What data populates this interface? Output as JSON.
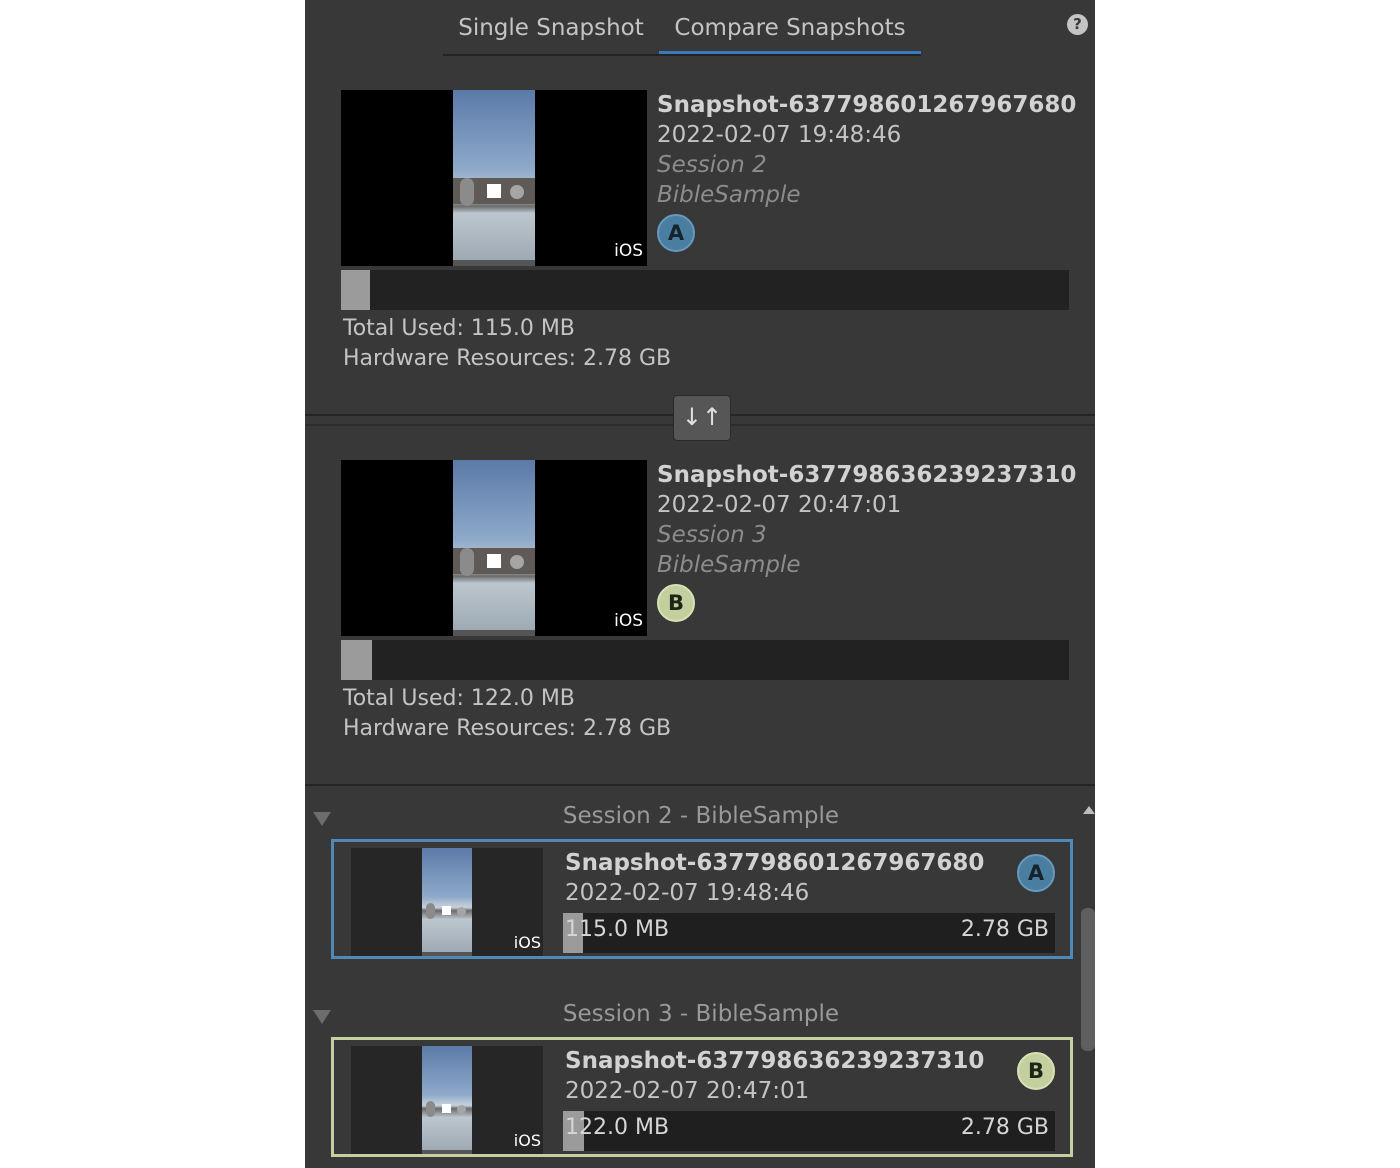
{
  "tabs": [
    {
      "label": "Single Snapshot",
      "active": false
    },
    {
      "label": "Compare Snapshots",
      "active": true
    }
  ],
  "help_icon": "question-circle-icon",
  "snapshot_a": {
    "name": "Snapshot-637798601267967680",
    "date": "2022-02-07 19:48:46",
    "session": "Session 2",
    "project": "BibleSample",
    "platform": "iOS",
    "badge": "A",
    "used_fraction": 0.04,
    "total_used": "Total Used: 115.0 MB",
    "hardware": "Hardware Resources: 2.78 GB"
  },
  "swap_icon": "swap-vertical-icon",
  "snapshot_b": {
    "name": "Snapshot-637798636239237310",
    "date": "2022-02-07 20:47:01",
    "session": "Session 3",
    "project": "BibleSample",
    "platform": "iOS",
    "badge": "B",
    "used_fraction": 0.042,
    "total_used": "Total Used: 122.0 MB",
    "hardware": "Hardware Resources: 2.78 GB"
  },
  "list": {
    "sessions": [
      {
        "header": "Session 2 - BibleSample",
        "item": {
          "name": "Snapshot-637798601267967680",
          "date": "2022-02-07 19:48:46",
          "used": "115.0 MB",
          "total": "2.78 GB",
          "platform": "iOS",
          "badge": "A",
          "used_fraction": 0.04
        }
      },
      {
        "header": "Session 3 - BibleSample",
        "item": {
          "name": "Snapshot-637798636239237310",
          "date": "2022-02-07 20:47:01",
          "used": "122.0 MB",
          "total": "2.78 GB",
          "platform": "iOS",
          "badge": "B",
          "used_fraction": 0.042
        }
      }
    ]
  },
  "colors": {
    "panel_bg": "#383838",
    "tab_active_underline": "#3a79bb",
    "badge_a": "#4a7ea1",
    "badge_b": "#c3cf9e",
    "border_a": "#4f89b7",
    "border_b": "#c4d0a0"
  }
}
